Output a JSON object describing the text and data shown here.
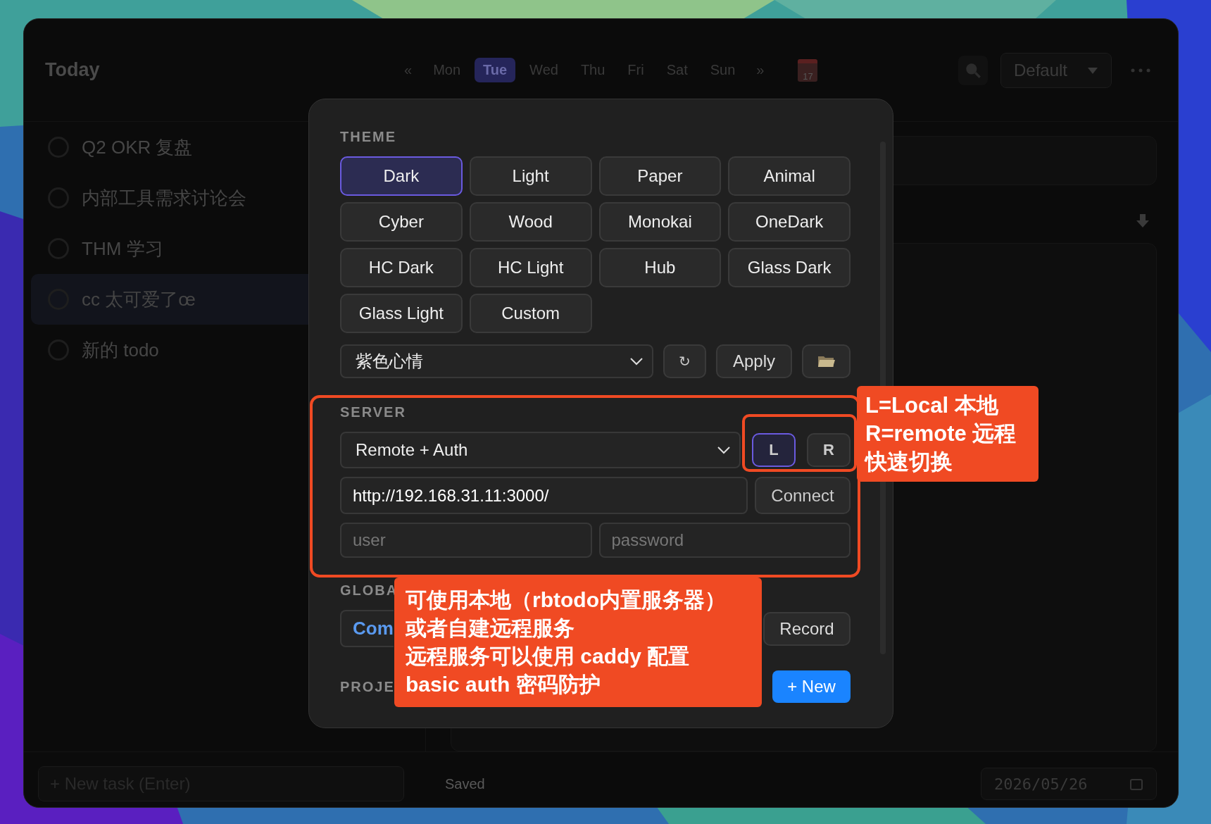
{
  "sidebar": {
    "title": "Today",
    "tasks": [
      {
        "text": "Q2 OKR 复盘",
        "selected": false
      },
      {
        "text": "内部工具需求讨论会",
        "selected": false
      },
      {
        "text": "THM 学习",
        "selected": false
      },
      {
        "text": "cc 太可爱了œ",
        "selected": true
      },
      {
        "text": "新的 todo",
        "selected": false
      }
    ],
    "new_task": {
      "placeholder": "+ New task (Enter)"
    }
  },
  "week_nav": {
    "prev": "«",
    "next": "»",
    "calendar_day": "17",
    "days": [
      {
        "label": "Mon",
        "selected": false
      },
      {
        "label": "Tue",
        "selected": true
      },
      {
        "label": "Wed",
        "selected": false
      },
      {
        "label": "Thu",
        "selected": false
      },
      {
        "label": "Fri",
        "selected": false
      },
      {
        "label": "Sat",
        "selected": false
      },
      {
        "label": "Sun",
        "selected": false
      }
    ]
  },
  "toolbar": {
    "project": "Default"
  },
  "status_bar": {
    "status": "Saved",
    "date": "2026/05/26"
  },
  "settings": {
    "theme_label": "THEME",
    "themes": [
      {
        "label": "Dark",
        "selected": true
      },
      {
        "label": "Light",
        "selected": false
      },
      {
        "label": "Paper",
        "selected": false
      },
      {
        "label": "Animal",
        "selected": false
      },
      {
        "label": "Cyber",
        "selected": false
      },
      {
        "label": "Wood",
        "selected": false
      },
      {
        "label": "Monokai",
        "selected": false
      },
      {
        "label": "OneDark",
        "selected": false
      },
      {
        "label": "HC Dark",
        "selected": false
      },
      {
        "label": "HC Light",
        "selected": false
      },
      {
        "label": "Hub",
        "selected": false
      },
      {
        "label": "Glass Dark",
        "selected": false
      },
      {
        "label": "Glass Light",
        "selected": false
      },
      {
        "label": "Custom",
        "selected": false
      }
    ],
    "custom_theme": "紫色心情",
    "refresh": "↻",
    "apply": "Apply",
    "server_label": "SERVER",
    "server_mode": "Remote + Auth",
    "quick_switch": [
      {
        "label": "L",
        "selected": true
      },
      {
        "label": "R",
        "selected": false
      }
    ],
    "url": "http://192.168.31.11:3000/",
    "connect": "Connect",
    "user": {
      "placeholder": "user"
    },
    "password": {
      "placeholder": "password"
    },
    "global_label": "GLOBA",
    "global_value": "Com",
    "record": "Record",
    "projects_label": "PROJE",
    "new_project": "+ New"
  },
  "annotations": [
    {
      "lines": [
        "L=Local 本地",
        "R=remote 远程",
        "快速切换"
      ]
    },
    {
      "lines": [
        "可使用本地（rbtodo内置服务器）",
        "或者自建远程服务",
        "远程服务可以使用 caddy 配置",
        "basic auth 密码防护"
      ]
    }
  ]
}
